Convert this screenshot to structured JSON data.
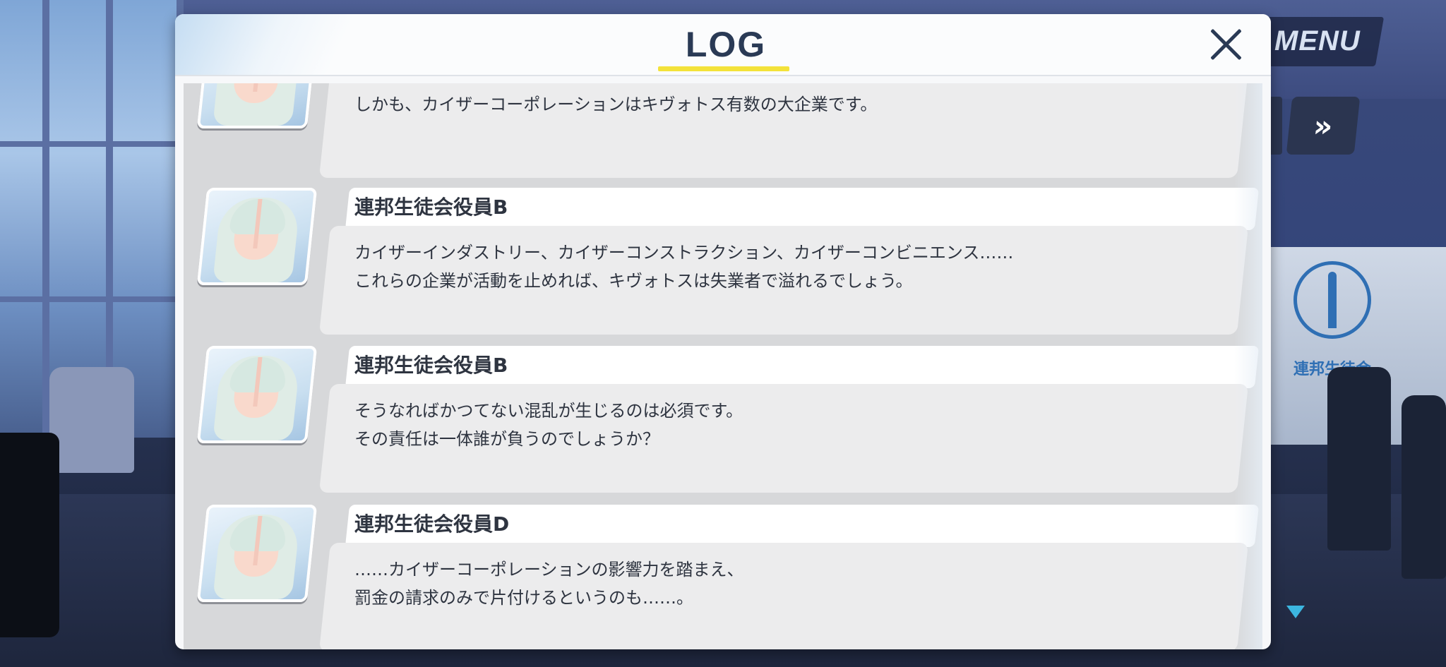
{
  "background": {
    "menu_label": "MENU",
    "fast_forward_icon": "double-chevron-right-icon",
    "emblem_text": "連邦生徒会",
    "scroll_indicator_color": "#3cb6e0"
  },
  "log_window": {
    "title": "LOG",
    "accent_color": "#f3e23a",
    "close_icon": "close-x-icon",
    "entries": [
      {
        "speaker": "",
        "lines": [
          "しかも、カイザーコーポレーションはキヴォトス有数の大企業です。"
        ]
      },
      {
        "speaker": "連邦生徒会役員B",
        "lines": [
          "カイザーインダストリー、カイザーコンストラクション、カイザーコンビニエンス……",
          "これらの企業が活動を止めれば、キヴォトスは失業者で溢れるでしょう。"
        ]
      },
      {
        "speaker": "連邦生徒会役員B",
        "lines": [
          "そうなればかつてない混乱が生じるのは必須です。",
          "その責任は一体誰が負うのでしょうか？"
        ]
      },
      {
        "speaker": "連邦生徒会役員D",
        "lines": [
          "……カイザーコーポレーションの影響力を踏まえ、",
          "罰金の請求のみで片付けるというのも……。"
        ]
      }
    ]
  }
}
